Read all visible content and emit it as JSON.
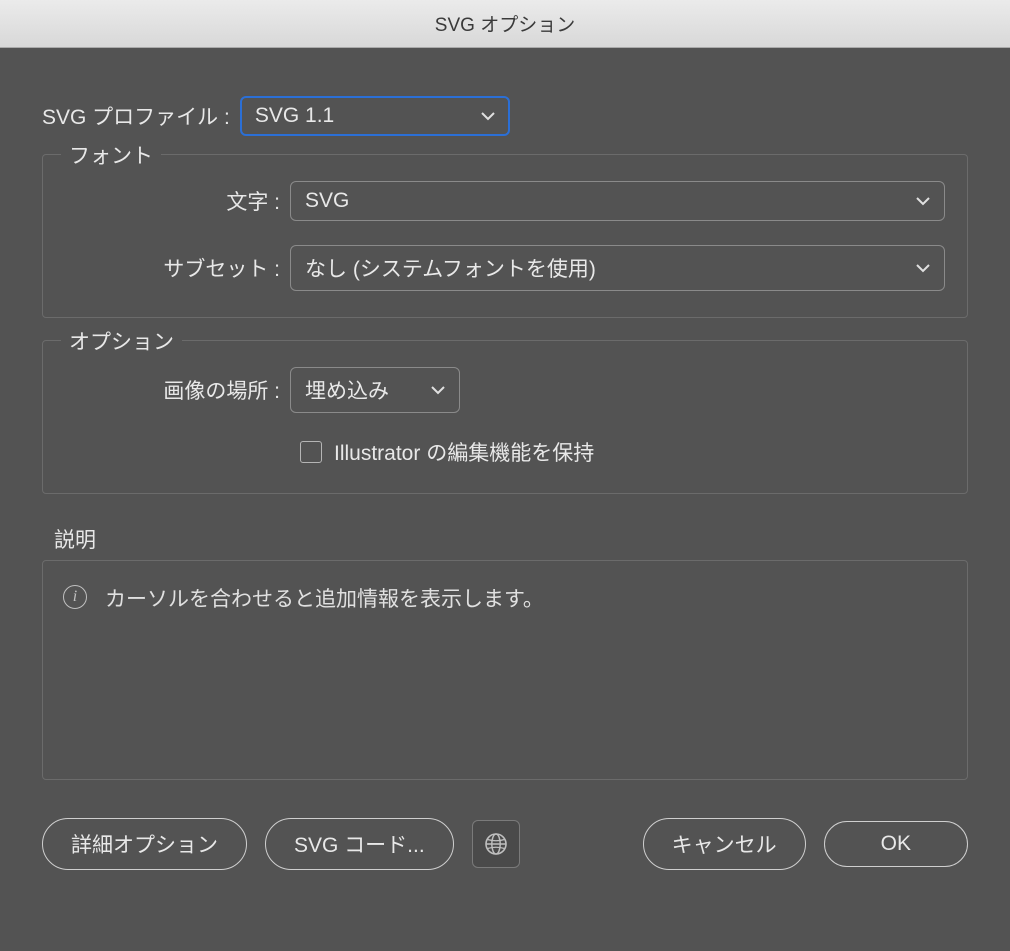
{
  "window": {
    "title": "SVG オプション"
  },
  "profile": {
    "label": "SVG プロファイル :",
    "value": "SVG 1.1"
  },
  "font_section": {
    "legend": "フォント",
    "type_label": "文字 :",
    "type_value": "SVG",
    "subset_label": "サブセット :",
    "subset_value": "なし (システムフォントを使用)"
  },
  "options_section": {
    "legend": "オプション",
    "image_label": "画像の場所 :",
    "image_value": "埋め込み",
    "preserve_label": "Illustrator の編集機能を保持"
  },
  "description": {
    "label": "説明",
    "text": "カーソルを合わせると追加情報を表示します。"
  },
  "buttons": {
    "more": "詳細オプション",
    "svg_code": "SVG コード...",
    "cancel": "キャンセル",
    "ok": "OK"
  }
}
